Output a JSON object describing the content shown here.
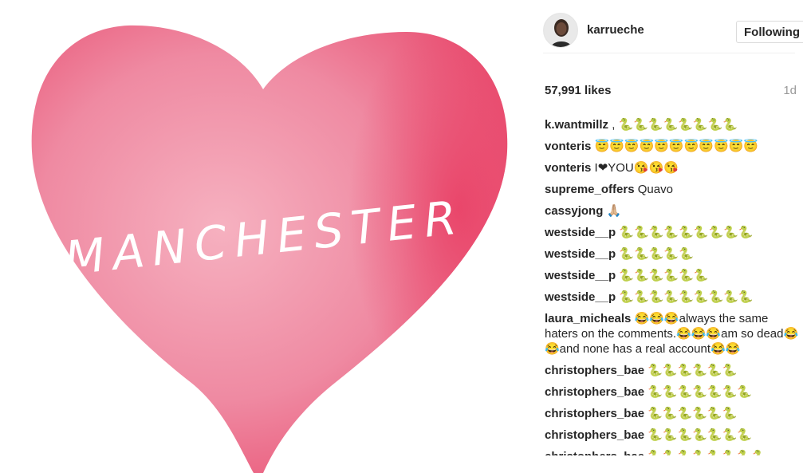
{
  "post": {
    "image_text": "MANCHESTER",
    "colors": {
      "heart_light": "#f6b1c0",
      "heart_mid": "#ef6f8b",
      "heart_dark": "#e84b6e",
      "text": "#ffffff"
    }
  },
  "header": {
    "username": "karrueche",
    "follow_label": "Following"
  },
  "meta": {
    "likes": "57,991 likes",
    "time": "1d"
  },
  "comments": [
    {
      "user": "k.wantmillz",
      "text": " , 🐍🐍🐍🐍🐍🐍🐍🐍"
    },
    {
      "user": "vonteris",
      "text": " 😇😇😇😇😇😇😇😇😇😇😇"
    },
    {
      "user": "vonteris",
      "text": " I❤YOU😘😘😘"
    },
    {
      "user": "supreme_offers",
      "text": " Quavo"
    },
    {
      "user": "cassyjong",
      "text": " 🙏🏼"
    },
    {
      "user": "westside__p",
      "text": " 🐍🐍🐍🐍🐍🐍🐍🐍🐍"
    },
    {
      "user": "westside__p",
      "text": " 🐍🐍🐍🐍🐍"
    },
    {
      "user": "westside__p",
      "text": " 🐍🐍🐍🐍🐍🐍"
    },
    {
      "user": "westside__p",
      "text": " 🐍🐍🐍🐍🐍🐍🐍🐍🐍"
    },
    {
      "user": "laura_micheals",
      "text": " 😂😂😂always the same haters on the comments.😂😂😂am so dead😂😂and none has a real account😂😂"
    },
    {
      "user": "christophers_bae",
      "text": " 🐍🐍🐍🐍🐍🐍"
    },
    {
      "user": "christophers_bae",
      "text": " 🐍🐍🐍🐍🐍🐍🐍"
    },
    {
      "user": "christophers_bae",
      "text": " 🐍🐍🐍🐍🐍🐍"
    },
    {
      "user": "christophers_bae",
      "text": " 🐍🐍🐍🐍🐍🐍🐍"
    },
    {
      "user": "christophers_bae",
      "text": " 🐍🐍🐍🐍🐍🐍🐍🐍"
    }
  ]
}
